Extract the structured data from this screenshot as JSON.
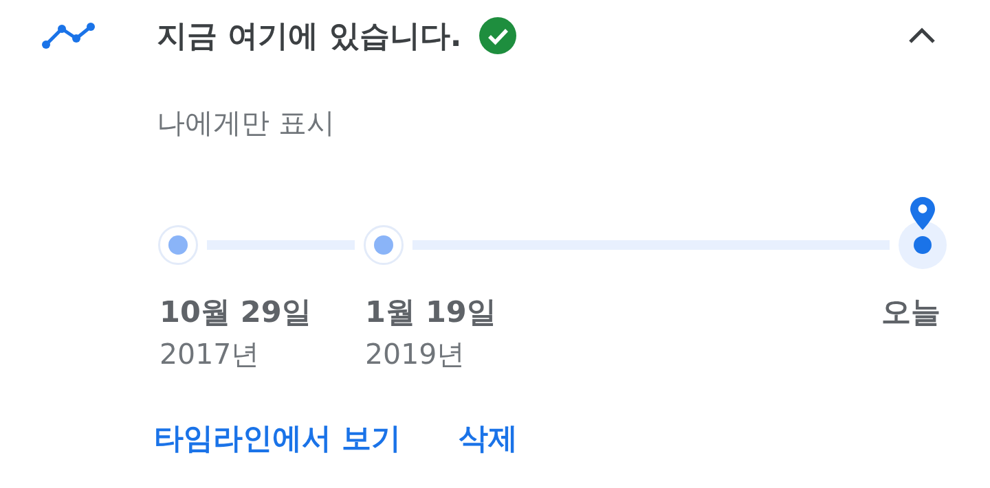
{
  "header": {
    "title": "지금 여기에 있습니다.",
    "verified": true,
    "expanded": true
  },
  "subtitle": "나에게만 표시",
  "timeline": {
    "stops": [
      {
        "date": "10월 29일",
        "year": "2017년",
        "current": false
      },
      {
        "date": "1월 19일",
        "year": "2019년",
        "current": false
      },
      {
        "date": "오늘",
        "current": true
      }
    ]
  },
  "actions": [
    {
      "label": "타임라인에서 보기"
    },
    {
      "label": "삭제"
    }
  ]
}
